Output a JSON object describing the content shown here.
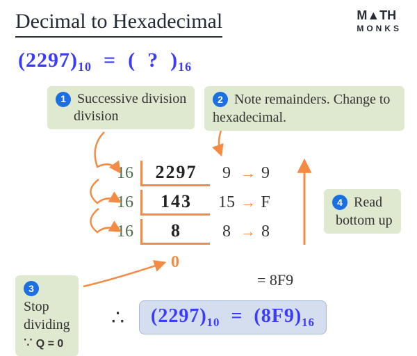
{
  "title": "Decimal to Hexadecimal",
  "logo": {
    "line1": "M▲TH",
    "line2": "MONKS"
  },
  "question": {
    "lhs_value": "2297",
    "lhs_base": "10",
    "rhs_placeholder": "?",
    "rhs_base": "16"
  },
  "steps": {
    "s1": {
      "num": "1",
      "text": "Successive division"
    },
    "s2": {
      "num": "2",
      "text": "Note remainders. Change to hexadecimal."
    },
    "s3": {
      "num": "3",
      "text_line1": "Stop",
      "text_line2": "dividing",
      "because": "∵",
      "cond": "Q = 0"
    },
    "s4": {
      "num": "4",
      "text_line1": "Read",
      "text_line2": "bottom up"
    }
  },
  "ladder": {
    "rows": [
      {
        "divisor": "16",
        "dividend": "2297",
        "remainder": "9",
        "hex": "9"
      },
      {
        "divisor": "16",
        "dividend": "143",
        "remainder": "15",
        "hex": "F"
      },
      {
        "divisor": "16",
        "dividend": "8",
        "remainder": "8",
        "hex": "8"
      }
    ],
    "final_quotient": "0"
  },
  "result_inline": "= 8F9",
  "therefore": "∴",
  "answer": {
    "lhs_value": "2297",
    "lhs_base": "10",
    "rhs_value": "8F9",
    "rhs_base": "16"
  },
  "colors": {
    "accent_orange": "#f38b44",
    "accent_blue": "#3b3bff",
    "badge_blue": "#1b6fe0",
    "callout_green": "#dfe9cf",
    "divisor_green": "#4a6e4a"
  }
}
